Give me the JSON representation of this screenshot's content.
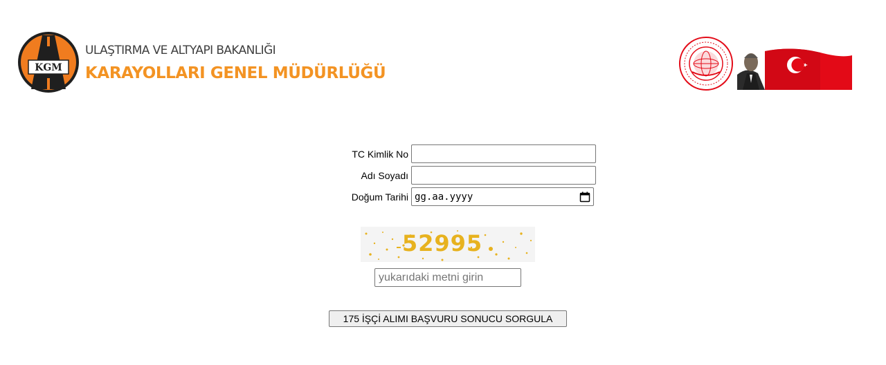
{
  "header": {
    "logo_text": "KGM",
    "ministry": "ULAŞTIRMA VE ALTYAPI BAKANLIĞI",
    "directorate": "KARAYOLLARI GENEL MÜDÜRLÜĞÜ"
  },
  "form": {
    "tc_label": "TC Kimlik No",
    "tc_value": "",
    "name_label": "Adı Soyadı",
    "name_value": "",
    "birth_label": "Doğum Tarihi",
    "birth_placeholder": "gg.aa.yyyy"
  },
  "captcha": {
    "text": "52995",
    "input_placeholder": "yukarıdaki metni girin"
  },
  "submit_label": "175 İŞÇİ ALIMI BAŞVURU SONUCU SORGULA",
  "colors": {
    "brand_orange": "#f39323",
    "ministry_red": "#e30a17",
    "captcha_gold": "#e7b21f"
  },
  "icons": [
    "calendar-icon"
  ]
}
